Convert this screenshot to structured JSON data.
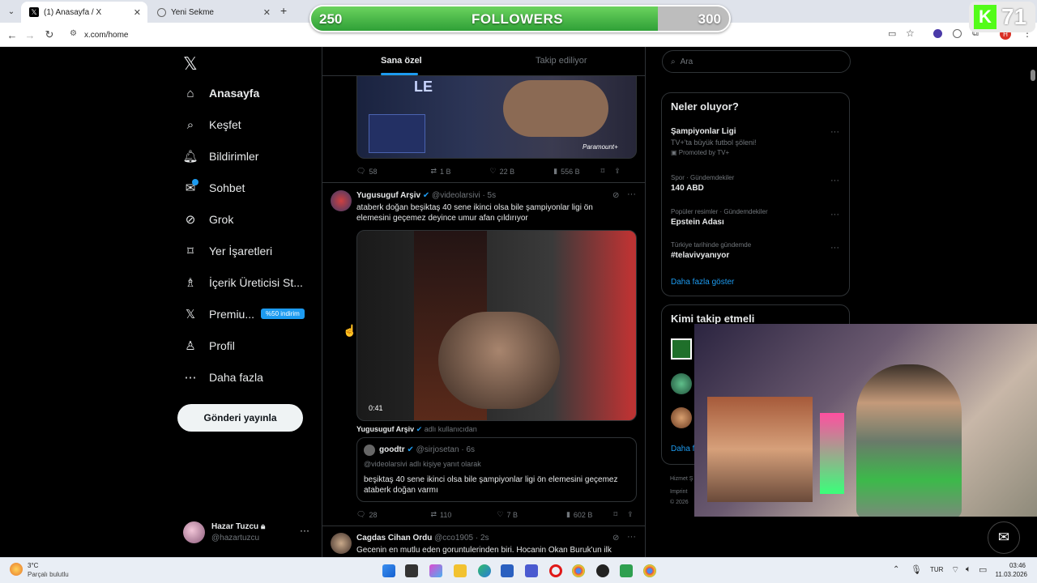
{
  "browser": {
    "tabs": [
      {
        "title": "(1) Anasayfa / X",
        "active": true
      },
      {
        "title": "Yeni Sekme",
        "active": false
      }
    ],
    "url": "x.com/home",
    "profile_letter": "H"
  },
  "overlay": {
    "followers_label": "FOLLOWERS",
    "current": "250",
    "goal": "300",
    "progress_fraction": 0.83,
    "kick_count": "71"
  },
  "sidebar": {
    "items": [
      {
        "label": "Anasayfa",
        "icon": "home-icon"
      },
      {
        "label": "Keşfet",
        "icon": "search-icon"
      },
      {
        "label": "Bildirimler",
        "icon": "bell-icon"
      },
      {
        "label": "Sohbet",
        "icon": "mail-icon"
      },
      {
        "label": "Grok",
        "icon": "grok-icon"
      },
      {
        "label": "Yer İşaretleri",
        "icon": "bookmark-icon"
      },
      {
        "label": "İçerik Üreticisi St...",
        "icon": "creator-icon"
      },
      {
        "label": "Premiu...",
        "icon": "x-icon"
      },
      {
        "label": "Profil",
        "icon": "person-icon"
      },
      {
        "label": "Daha fazla",
        "icon": "more-circle-icon"
      }
    ],
    "premium_badge": "%50 indirim",
    "post_button": "Gönderi yayınla",
    "user": {
      "name": "Hazar Tuzcu",
      "handle": "@hazartuzcu"
    }
  },
  "timeline": {
    "tabs": [
      "Sana özel",
      "Takip ediliyor"
    ],
    "first_post_stats": {
      "replies": "58",
      "reposts": "1 B",
      "likes": "22 B",
      "views": "556 B"
    },
    "first_post_image_text": "Paramount+",
    "post2": {
      "name": "Yugusuguf Arşiv",
      "handle": "@videolarsivi",
      "time": "· 5s",
      "text": "ataberk doğan beşiktaş 40 sene ikinci olsa bile şampiyonlar ligi ön elemesini geçemez deyince umur afan çıldırıyor",
      "video_time": "0:41",
      "caption_name": "Yugusuguf Arşiv",
      "caption_suffix": "adlı kullanıcıdan",
      "quote": {
        "name": "goodtr",
        "handle": "@sirjosetan",
        "time": "· 6s",
        "reply_to": "@videolarsivi adlı kişiye yanıt olarak",
        "text": "beşiktaş 40 sene ikinci olsa bile şampiyonlar ligi ön elemesini geçemez ataberk doğan varmı"
      },
      "stats": {
        "replies": "28",
        "reposts": "110",
        "likes": "7 B",
        "views": "602 B"
      }
    },
    "post3": {
      "name": "Cagdas Cihan Ordu",
      "handle": "@cco1905",
      "time": "· 2s",
      "text": "Gecenin en mutlu eden goruntulerinden biri. Hocanin Okan Buruk'un ilk"
    }
  },
  "right": {
    "search_placeholder": "Ara",
    "trends_title": "Neler oluyor?",
    "trends": [
      {
        "top": "Şampiyonlar Ligi",
        "sub": "TV+'ta büyük futbol şöleni!",
        "extra": "Promoted by TV+",
        "promoted": true
      },
      {
        "top": "Spor · Gündemdekiler",
        "sub": "140 ABD",
        "promoted": false
      },
      {
        "top": "Popüler resimler · Gündemdekiler",
        "sub": "Epstein Adası",
        "promoted": false
      },
      {
        "top": "Türkiye tarihinde gündemde",
        "sub": "#telavivyanıyor",
        "promoted": false
      }
    ],
    "show_more": "Daha fazla göster",
    "follow_title": "Kimi takip etmeli",
    "follow_show_more": "Daha f",
    "footer": [
      "Hizmet Ş",
      "Imprint",
      "© 2026"
    ]
  },
  "taskbar": {
    "weather_temp": "3°C",
    "weather_desc": "Parçalı bulutlu",
    "lang": "TUR",
    "time": "03:46",
    "date": "11.03.2026"
  },
  "colors": {
    "accent": "#1d9bf0",
    "follow_green": "#3cb94a"
  }
}
